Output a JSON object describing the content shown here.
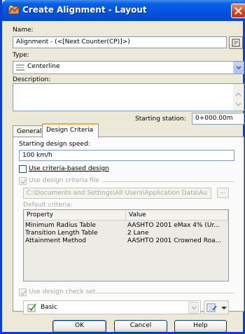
{
  "window": {
    "title": "Create Alignment - Layout",
    "icon": "alignment-app-icon",
    "close_icon": "close-icon"
  },
  "name": {
    "label": "Name:",
    "value": "Alignment - (<[Next Counter(CP)]>)"
  },
  "type": {
    "label": "Type:",
    "value": "Centerline"
  },
  "description": {
    "label": "Description:",
    "value": ""
  },
  "starting_station": {
    "label": "Starting station:",
    "value": "0+000.00m"
  },
  "tabs": [
    {
      "label": "General",
      "active": false
    },
    {
      "label": "Design Criteria",
      "active": true
    }
  ],
  "design_criteria": {
    "speed_label": "Starting design speed:",
    "speed_value": "100 km/h",
    "use_criteria_label": "Use criteria-based design",
    "use_criteria_checked": false,
    "use_file_label": "Use design criteria file",
    "use_file_checked": true,
    "file_path": "C:\\Documents and Settings\\All Users\\Application Data\\Au",
    "browse_label": "...",
    "default_criteria_label": "Default criteria:",
    "table": {
      "columns": [
        "Property",
        "Value"
      ],
      "rows": [
        [
          "Minimum Radius Table",
          "AASHTO 2001 eMax 4% (Ur..."
        ],
        [
          "Transition Length Table",
          "2 Lane"
        ],
        [
          "Attainment Method",
          "AASHTO 2001 Crowned Roa..."
        ]
      ]
    },
    "use_check_set_label": "Use design check set",
    "use_check_set_checked": true,
    "check_set_value": "Basic"
  },
  "buttons": {
    "ok": "OK",
    "cancel": "Cancel",
    "help": "Help"
  },
  "colors": {
    "titlebar": "#0054e0",
    "dialog_bg": "#ece9d8",
    "active_tab_accent": "#f6a738"
  }
}
